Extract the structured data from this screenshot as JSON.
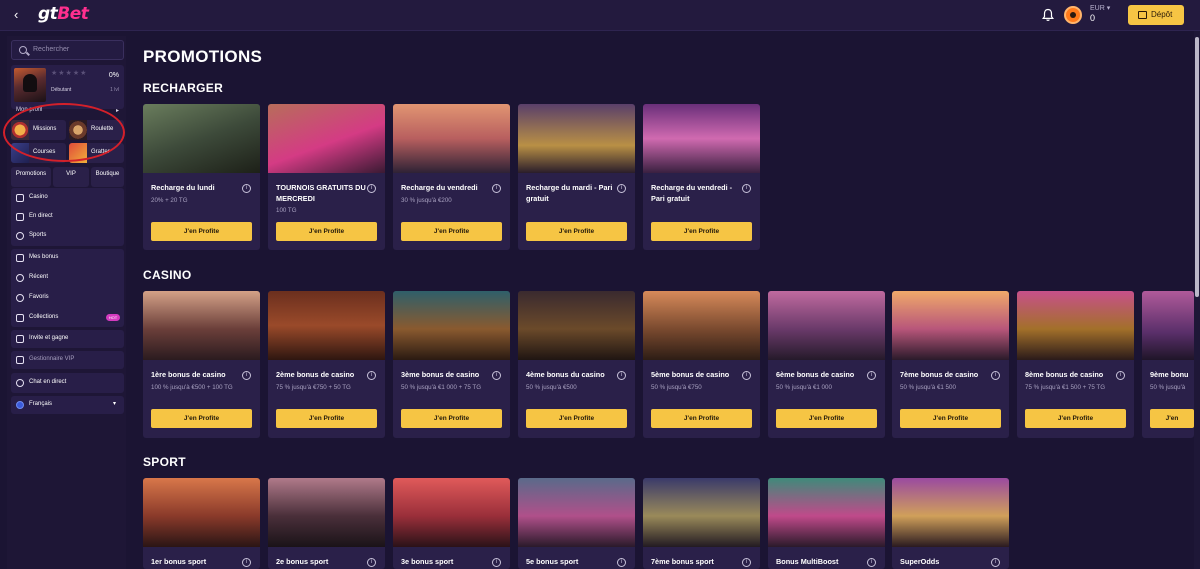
{
  "header": {
    "logo_part1": "gt",
    "logo_part2": "Bet",
    "currency": "EUR ▾",
    "balance": "0",
    "deposit_label": "Dépôt"
  },
  "sidebar": {
    "search_placeholder": "Rechercher",
    "profile": {
      "stars": "★★★★★",
      "percent": "0%",
      "rank": "Débutant",
      "level": "1 lvl",
      "link": "Mon profil"
    },
    "tiles": [
      {
        "label": "Missions"
      },
      {
        "label": "Roulette"
      },
      {
        "label": "Courses"
      },
      {
        "label": "Gratter"
      }
    ],
    "tabs": [
      {
        "label": "Promotions"
      },
      {
        "label": "VIP"
      },
      {
        "label": "Boutique"
      }
    ],
    "nav1": [
      {
        "label": "Casino",
        "icon": "cards-icon"
      },
      {
        "label": "En direct",
        "icon": "live-icon"
      },
      {
        "label": "Sports",
        "icon": "ball-icon"
      }
    ],
    "nav2": [
      {
        "label": "Mes bonus",
        "icon": "bonus-icon"
      },
      {
        "label": "Récent",
        "icon": "clock-icon"
      },
      {
        "label": "Favoris",
        "icon": "heart-icon"
      },
      {
        "label": "Collections",
        "icon": "collections-icon",
        "badge": "HOT"
      }
    ],
    "invite": "Invite et gagne",
    "vip_manager": "Gestionnaire VIP",
    "chat": "Chat en direct",
    "language": "Français"
  },
  "main": {
    "title": "PROMOTIONS",
    "sections": [
      {
        "title": "RECHARGER",
        "cards": [
          {
            "title": "Recharge du lundi",
            "subtitle": "20% + 20 TG",
            "button": "J'en Profite"
          },
          {
            "title": "TOURNOIS GRATUITS DU MERCREDI",
            "subtitle": "100 TG",
            "button": "J'en Profite"
          },
          {
            "title": "Recharge du vendredi",
            "subtitle": "30 % jusqu'à €200",
            "button": "J'en Profite"
          },
          {
            "title": "Recharge du mardi - Pari gratuit",
            "subtitle": "",
            "button": "J'en Profite"
          },
          {
            "title": "Recharge du vendredi - Pari gratuit",
            "subtitle": "",
            "button": "J'en Profite"
          }
        ]
      },
      {
        "title": "CASINO",
        "cards": [
          {
            "title": "1ère bonus de casino",
            "subtitle": "100 % jusqu'à €500 + 100 TG",
            "button": "J'en Profite"
          },
          {
            "title": "2ème bonus de casino",
            "subtitle": "75 % jusqu'à €750 + 50 TG",
            "button": "J'en Profite"
          },
          {
            "title": "3ème bonus de casino",
            "subtitle": "50 % jusqu'à €1 000 + 75 TG",
            "button": "J'en Profite"
          },
          {
            "title": "4ème bonus du casino",
            "subtitle": "50 % jusqu'à €500",
            "button": "J'en Profite"
          },
          {
            "title": "5ème bonus de casino",
            "subtitle": "50 % jusqu'à €750",
            "button": "J'en Profite"
          },
          {
            "title": "6ème bonus de casino",
            "subtitle": "50 % jusqu'à €1 000",
            "button": "J'en Profite"
          },
          {
            "title": "7ème bonus de casino",
            "subtitle": "50 % jusqu'à €1 500",
            "button": "J'en Profite"
          },
          {
            "title": "8ème bonus de casino",
            "subtitle": "75 % jusqu'à €1 500 + 75 TG",
            "button": "J'en Profite"
          },
          {
            "title": "9ème bonu",
            "subtitle": "50 % jusqu'à",
            "button": "J'en"
          }
        ]
      },
      {
        "title": "SPORT",
        "cards": [
          {
            "title": "1er bonus sport"
          },
          {
            "title": "2e bonus sport"
          },
          {
            "title": "3e bonus sport"
          },
          {
            "title": "5e bonus sport"
          },
          {
            "title": "7ème bonus sport"
          },
          {
            "title": "Bonus MultiBoost"
          },
          {
            "title": "SuperOdds"
          }
        ]
      }
    ]
  },
  "colors": {
    "accent": "#f6c544",
    "brand_pink": "#ff2f8e",
    "background": "#1b1433",
    "card": "#2a2049",
    "annotation": "#d4202a"
  }
}
